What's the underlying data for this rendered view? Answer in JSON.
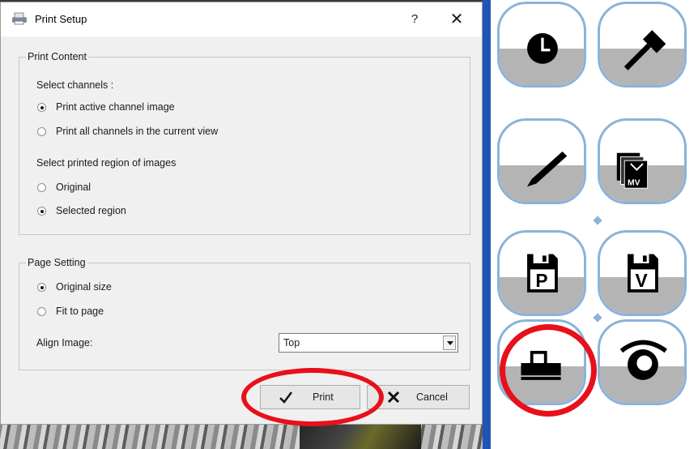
{
  "dialog": {
    "title": "Print Setup",
    "help_label": "?",
    "close_label": "✕",
    "print_content": {
      "legend": "Print Content",
      "select_channels_label": "Select channels :",
      "channel_options": [
        {
          "label": "Print active channel image",
          "selected": true
        },
        {
          "label": "Print all channels in the current view",
          "selected": false
        }
      ],
      "region_label": "Select printed region of images",
      "region_options": [
        {
          "label": "Original",
          "selected": false
        },
        {
          "label": "Selected region",
          "selected": true
        }
      ]
    },
    "page_setting": {
      "legend": "Page Setting",
      "size_options": [
        {
          "label": "Original size",
          "selected": true
        },
        {
          "label": "Fit to page",
          "selected": false
        }
      ],
      "align_label": "Align Image:",
      "align_value": "Top"
    },
    "buttons": {
      "print_label": "Print",
      "cancel_label": "Cancel"
    }
  },
  "toolbar": {
    "buttons": [
      {
        "name": "clock-icon"
      },
      {
        "name": "hammer-icon"
      },
      {
        "name": "pen-icon"
      },
      {
        "name": "multi-view-icon",
        "text": "MV"
      },
      {
        "name": "save-p-icon",
        "text": "P"
      },
      {
        "name": "save-v-icon",
        "text": "V"
      },
      {
        "name": "printer-icon"
      },
      {
        "name": "eye-icon"
      }
    ],
    "accent_color": "#8ab3dc",
    "highlight_color": "#e8101a"
  }
}
